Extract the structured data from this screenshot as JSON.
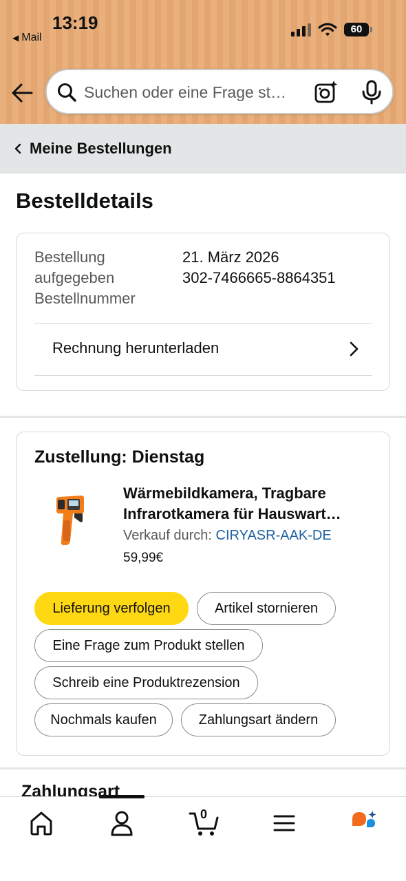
{
  "status_bar": {
    "time": "13:19",
    "back_app": "Mail",
    "battery": "60"
  },
  "search": {
    "placeholder": "Suchen oder eine Frage st…"
  },
  "breadcrumb": {
    "label": "Meine Bestellungen"
  },
  "page": {
    "title": "Bestelldetails"
  },
  "order": {
    "placed_label_line1": "Bestellung",
    "placed_label_line2": "aufgegeben",
    "placed_value": "21. März 2026",
    "number_label": "Bestellnummer",
    "number_value": "302-7466665-8864351",
    "invoice_label": "Rechnung herunterladen"
  },
  "delivery": {
    "heading": "Zustellung: Dienstag",
    "product": {
      "title_line1": "Wärmebildkamera, Tragbare",
      "title_line2": "Infrarotkamera für Hauswart…",
      "seller_prefix": "Verkauf durch: ",
      "seller_name": "CIRYASR-AAK-DE",
      "price": "59,99€"
    },
    "actions": {
      "track": "Lieferung verfolgen",
      "cancel": "Artikel stornieren",
      "question": "Eine Frage zum Produkt stellen",
      "review": "Schreib eine Produktrezension",
      "rebuy": "Nochmals kaufen",
      "payment": "Zahlungsart ändern"
    }
  },
  "next_section": {
    "heading": "Zahlungsart"
  },
  "bottom_nav": {
    "cart_count": "0"
  },
  "colors": {
    "header_bg": "#e9b07e",
    "primary_button": "#ffd814",
    "link": "#2162a1",
    "rufus_orange": "#f26b1d",
    "rufus_blue": "#1b8fe0"
  }
}
